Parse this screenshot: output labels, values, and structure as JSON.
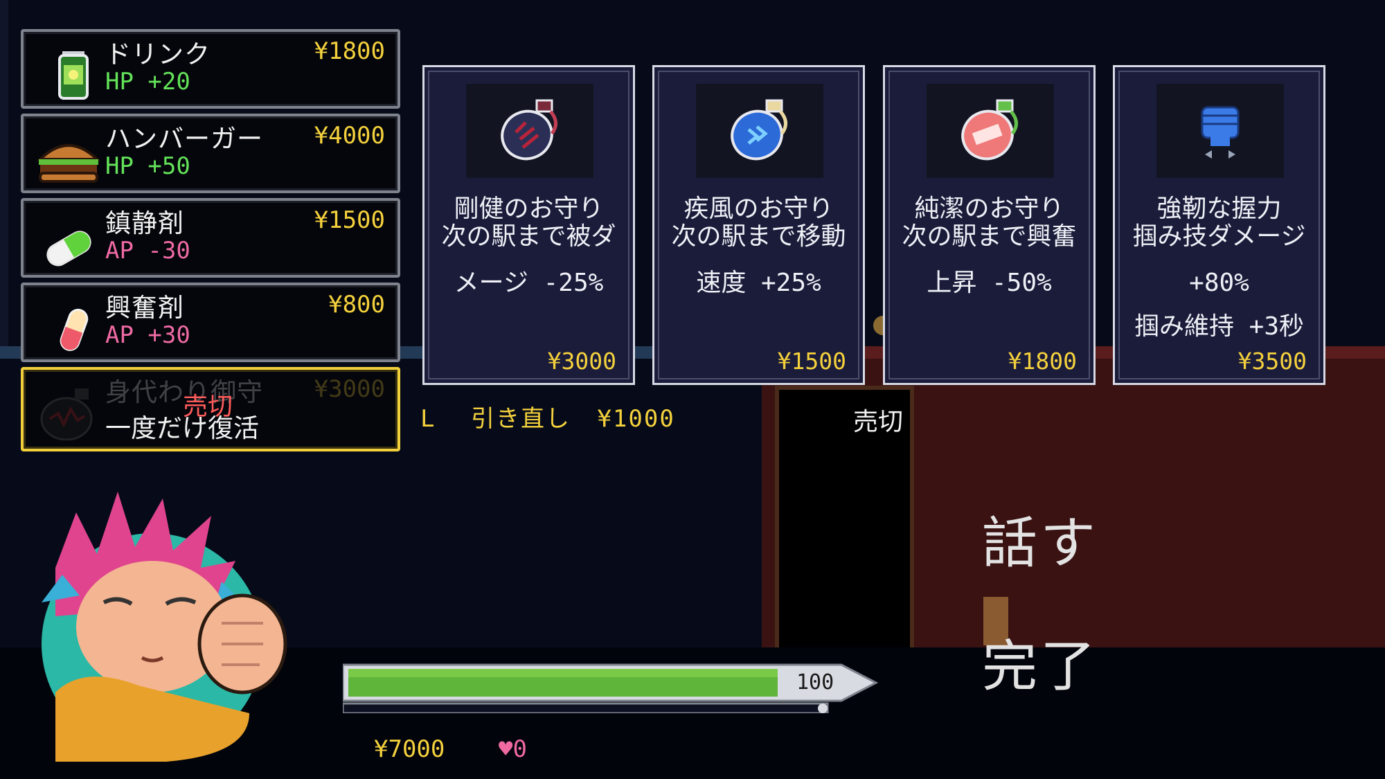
{
  "consumables": [
    {
      "name": "ドリンク",
      "price": "¥1800",
      "effect": "HP +20",
      "effect_type": "hp",
      "icon": "drink-can-icon"
    },
    {
      "name": "ハンバーガー",
      "price": "¥4000",
      "effect": "HP +50",
      "effect_type": "hp",
      "icon": "hamburger-icon"
    },
    {
      "name": "鎮静剤",
      "price": "¥1500",
      "effect": "AP -30",
      "effect_type": "ap",
      "icon": "green-pill-icon"
    },
    {
      "name": "興奮剤",
      "price": "¥800",
      "effect": "AP +30",
      "effect_type": "ap",
      "icon": "red-pill-icon"
    },
    {
      "name": "身代わり御守",
      "price": "¥3000",
      "effect": "一度だけ復活",
      "sold_label": "売切",
      "icon": "charm-bag-icon"
    }
  ],
  "charms": [
    {
      "title": "剛健のお守り",
      "line1": "次の駅まで被ダ",
      "line2": "メージ -25%",
      "line3": "",
      "price": "¥3000",
      "icon": "red-charm-bag-icon"
    },
    {
      "title": "疾風のお守り",
      "line1": "次の駅まで移動",
      "line2": "速度 +25%",
      "line3": "",
      "price": "¥1500",
      "icon": "blue-charm-bag-icon"
    },
    {
      "title": "純潔のお守り",
      "line1": "次の駅まで興奮",
      "line2": "上昇 -50%",
      "line3": "",
      "price": "¥1800",
      "icon": "pink-charm-bag-icon"
    },
    {
      "title": "強靭な握力",
      "line1": "掴み技ダメージ",
      "line2": "+80%",
      "line3": "掴み維持 +3秒",
      "price": "¥3500",
      "icon": "fist-icon"
    }
  ],
  "reroll": {
    "key": "L",
    "label": "引き直し",
    "price": "¥1000"
  },
  "sold_out_label": "売切",
  "menu": {
    "talk": "話す",
    "done": "完了"
  },
  "status": {
    "hp_value": "100",
    "hp_fraction": 1.0,
    "money": "¥7000",
    "hearts": "0"
  },
  "colors": {
    "price": "#f4d13c",
    "hp": "#64e35a",
    "ap": "#ef6aa4",
    "selected_border": "#f1cf3c",
    "hp_bar": "#5fb53a"
  }
}
